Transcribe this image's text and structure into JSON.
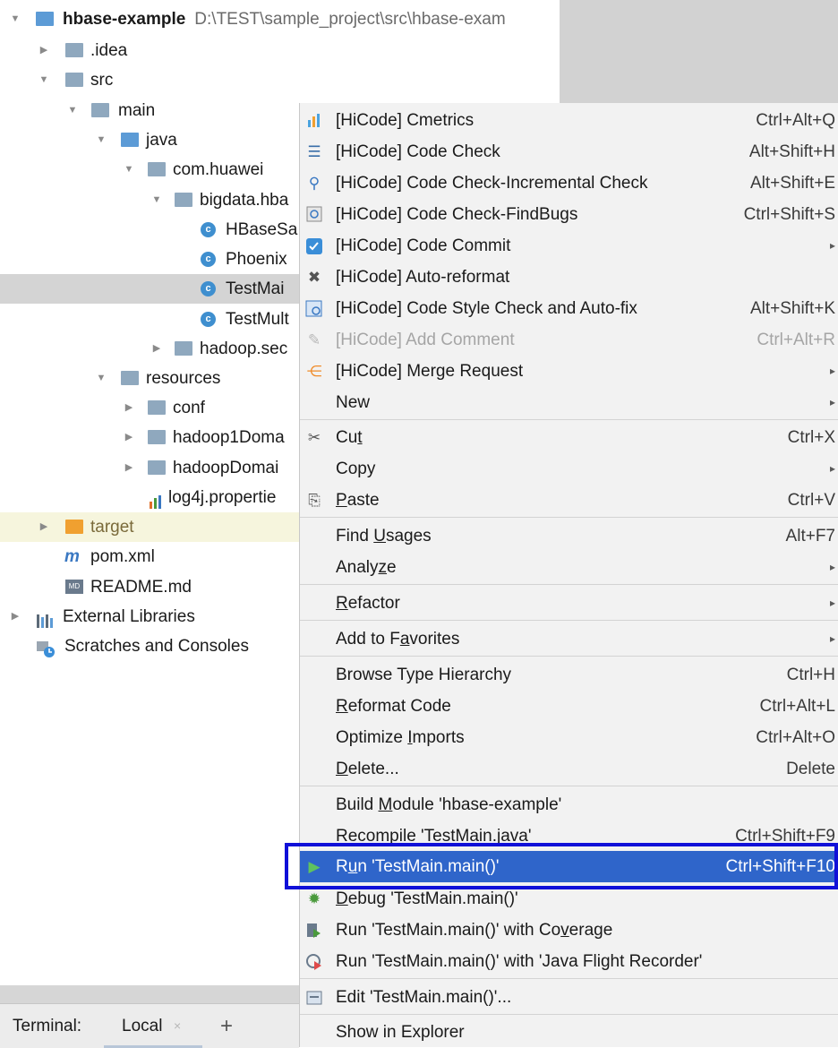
{
  "tree": {
    "root": {
      "label": "hbase-example",
      "path": "D:\\TEST\\sample_project\\src\\hbase-exam"
    },
    "idea": ".idea",
    "src": "src",
    "main": "main",
    "java": "java",
    "com_huawei": "com.huawei",
    "bigdata": "bigdata.hba",
    "hbasesa": "HBaseSa",
    "phoenix": "Phoenix",
    "testmain": "TestMai",
    "testmult": "TestMult",
    "hadoop_sec": "hadoop.sec",
    "resources": "resources",
    "conf": "conf",
    "hadoop1": "hadoop1Doma",
    "hadoopdomain": "hadoopDomai",
    "log4j": "log4j.propertie",
    "target": "target",
    "pom": "pom.xml",
    "readme": "README.md",
    "extlib": "External Libraries",
    "scratches": "Scratches and Consoles",
    "class_letter": "c",
    "m_letter": "m",
    "md_badge": "MD"
  },
  "menu": {
    "cmetrics": {
      "label": "[HiCode] Cmetrics",
      "shortcut": "Ctrl+Alt+Q"
    },
    "code_check": {
      "label": "[HiCode] Code Check",
      "shortcut": "Alt+Shift+H"
    },
    "code_check_inc": {
      "label": "[HiCode] Code Check-Incremental Check",
      "shortcut": "Alt+Shift+E"
    },
    "findbugs": {
      "label": "[HiCode] Code Check-FindBugs",
      "shortcut": "Ctrl+Shift+S"
    },
    "commit": {
      "label": "[HiCode] Code Commit"
    },
    "reformat": {
      "label": "[HiCode] Auto-reformat"
    },
    "style_check": {
      "label": "[HiCode] Code Style Check and Auto-fix",
      "shortcut": "Alt+Shift+K"
    },
    "add_comment": {
      "label": "[HiCode] Add Comment",
      "shortcut": "Ctrl+Alt+R"
    },
    "merge": {
      "label": "[HiCode] Merge Request"
    },
    "new": {
      "label": "New"
    },
    "cut": {
      "pre": "Cu",
      "u": "t",
      "post": "",
      "shortcut": "Ctrl+X"
    },
    "copy": {
      "label": "Copy"
    },
    "paste": {
      "pre": "",
      "u": "P",
      "post": "aste",
      "shortcut": "Ctrl+V"
    },
    "find_usages": {
      "pre": "Find ",
      "u": "U",
      "post": "sages",
      "shortcut": "Alt+F7"
    },
    "analyze": {
      "pre": "Analy",
      "u": "z",
      "post": "e"
    },
    "refactor": {
      "pre": "",
      "u": "R",
      "post": "efactor"
    },
    "favorites": {
      "pre": "Add to F",
      "u": "a",
      "post": "vorites"
    },
    "hierarchy": {
      "label": "Browse Type Hierarchy",
      "shortcut": "Ctrl+H"
    },
    "reformat_code": {
      "pre": "",
      "u": "R",
      "post": "eformat Code",
      "shortcut": "Ctrl+Alt+L"
    },
    "optimize": {
      "pre": "Optimize ",
      "u": "I",
      "post": "mports",
      "shortcut": "Ctrl+Alt+O"
    },
    "delete": {
      "pre": "",
      "u": "D",
      "post": "elete...",
      "shortcut": "Delete"
    },
    "build": {
      "pre": "Build ",
      "u": "M",
      "post": "odule 'hbase-example'"
    },
    "recompile": {
      "label": "Recompile 'TestMain.java'",
      "shortcut": "Ctrl+Shift+F9"
    },
    "run": {
      "pre": "R",
      "u": "u",
      "post": "n 'TestMain.main()'",
      "shortcut": "Ctrl+Shift+F10"
    },
    "debug": {
      "pre": "",
      "u": "D",
      "post": "ebug 'TestMain.main()'"
    },
    "coverage": {
      "pre": "Run 'TestMain.main()' with Co",
      "u": "v",
      "post": "erage"
    },
    "jfr": {
      "label": "Run 'TestMain.main()' with 'Java Flight Recorder'"
    },
    "edit": {
      "label": "Edit 'TestMain.main()'..."
    },
    "explorer": {
      "label": "Show in Explorer"
    },
    "submenu_arrow": "▸"
  },
  "bottom": {
    "terminal": "Terminal:",
    "tab": "Local",
    "close": "×",
    "add": "+"
  },
  "colors": {
    "highlight": "#2f65ca",
    "callout": "#1010d8",
    "menu_bg": "#f2f2f2"
  }
}
